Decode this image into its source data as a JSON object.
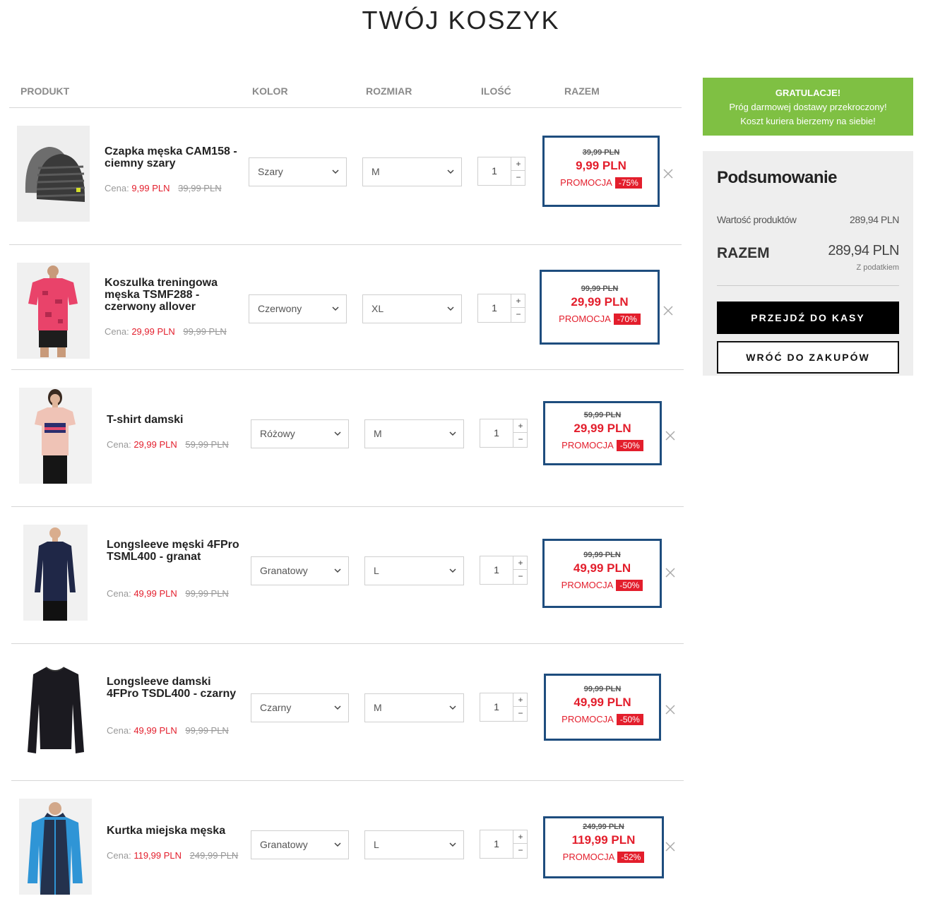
{
  "page": {
    "title": "TWÓJ KOSZYK"
  },
  "table": {
    "headers": {
      "product": "PRODUKT",
      "color": "KOLOR",
      "size": "ROZMIAR",
      "qty": "ILOŚĆ",
      "total": "RAZEM"
    }
  },
  "labels": {
    "price_prefix": "Cena:",
    "promo": "PROMOCJA"
  },
  "items": [
    {
      "name": "Czapka męska CAM158 - ciemny szary",
      "price": "9,99 PLN",
      "old_price": "39,99 PLN",
      "color": "Szary",
      "size": "M",
      "qty": "1",
      "total": "9,99 PLN",
      "discount": "-75%"
    },
    {
      "name": "Koszulka treningowa męska TSMF288 - czerwony allover",
      "price": "29,99 PLN",
      "old_price": "99,99 PLN",
      "color": "Czerwony",
      "size": "XL",
      "qty": "1",
      "total": "29,99 PLN",
      "discount": "-70%"
    },
    {
      "name": "T-shirt damski",
      "price": "29,99 PLN",
      "old_price": "59,99 PLN",
      "color": "Różowy",
      "size": "M",
      "qty": "1",
      "total": "29,99 PLN",
      "discount": "-50%"
    },
    {
      "name": "Longsleeve męski 4FPro TSML400 - granat",
      "price": "49,99 PLN",
      "old_price": "99,99 PLN",
      "color": "Granatowy",
      "size": "L",
      "qty": "1",
      "total": "49,99 PLN",
      "discount": "-50%"
    },
    {
      "name": "Longsleeve damski 4FPro TSDL400 - czarny",
      "price": "49,99 PLN",
      "old_price": "99,99 PLN",
      "color": "Czarny",
      "size": "M",
      "qty": "1",
      "total": "49,99 PLN",
      "discount": "-50%"
    },
    {
      "name": "Kurtka miejska męska",
      "price": "119,99 PLN",
      "old_price": "249,99 PLN",
      "color": "Granatowy",
      "size": "L",
      "qty": "1",
      "total": "119,99 PLN",
      "discount": "-52%"
    }
  ],
  "congrats": {
    "title": "GRATULACJE!",
    "line1": "Próg darmowej dostawy przekroczony!",
    "line2": "Koszt kuriera bierzemy na siebie!"
  },
  "summary": {
    "heading": "Podsumowanie",
    "products_label": "Wartość produktów",
    "products_value": "289,94 PLN",
    "total_label": "RAZEM",
    "total_value": "289,94 PLN",
    "tax_note": "Z podatkiem",
    "checkout_button": "PRZEJDŹ DO KASY",
    "back_button": "WRÓĆ DO ZAKUPÓW"
  },
  "colors": {
    "accent_red": "#e31e2c",
    "highlight_blue": "#1e4d7e",
    "success_green": "#7fc043"
  },
  "icons": [
    "chevron-down-icon",
    "plus-icon",
    "minus-icon",
    "close-icon"
  ]
}
